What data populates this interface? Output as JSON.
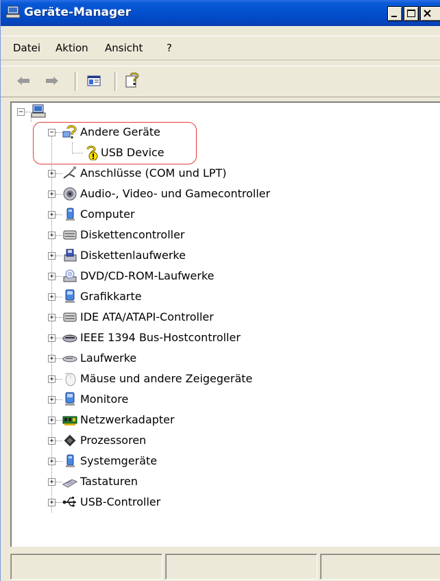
{
  "window": {
    "title": "Geräte-Manager"
  },
  "menu": {
    "items": [
      {
        "label": "Datei"
      },
      {
        "label": "Aktion"
      },
      {
        "label": "Ansicht"
      },
      {
        "label": "?"
      }
    ]
  },
  "toolbar": {
    "buttons": [
      {
        "icon": "back-arrow-icon"
      },
      {
        "icon": "forward-arrow-icon"
      },
      {
        "icon": "properties-icon"
      },
      {
        "icon": "help-icon"
      }
    ]
  },
  "tree": {
    "root": {
      "icon": "computer-icon",
      "expanded": true
    },
    "groups": [
      {
        "label": "Andere Geräte",
        "expanded": true,
        "icon": "unknown-device-icon",
        "children": [
          {
            "label": "USB Device",
            "icon": "warning-device-icon"
          }
        ]
      },
      {
        "label": "Anschlüsse (COM und LPT)",
        "icon": "port-icon"
      },
      {
        "label": "Audio-, Video- und Gamecontroller",
        "icon": "speaker-icon"
      },
      {
        "label": "Computer",
        "icon": "computer-icon"
      },
      {
        "label": "Diskettencontroller",
        "icon": "controller-icon"
      },
      {
        "label": "Diskettenlaufwerke",
        "icon": "floppy-icon"
      },
      {
        "label": "DVD/CD-ROM-Laufwerke",
        "icon": "cdrom-icon"
      },
      {
        "label": "Grafikkarte",
        "icon": "monitor-icon"
      },
      {
        "label": "IDE ATA/ATAPI-Controller",
        "icon": "controller-icon"
      },
      {
        "label": "IEEE 1394 Bus-Hostcontroller",
        "icon": "firewire-icon"
      },
      {
        "label": "Laufwerke",
        "icon": "drive-icon"
      },
      {
        "label": "Mäuse und andere Zeigegeräte",
        "icon": "mouse-icon"
      },
      {
        "label": "Monitore",
        "icon": "monitor-icon"
      },
      {
        "label": "Netzwerkadapter",
        "icon": "network-card-icon"
      },
      {
        "label": "Prozessoren",
        "icon": "processor-icon"
      },
      {
        "label": "Systemgeräte",
        "icon": "system-device-icon"
      },
      {
        "label": "Tastaturen",
        "icon": "keyboard-icon"
      },
      {
        "label": "USB-Controller",
        "icon": "usb-icon"
      }
    ]
  },
  "colors": {
    "titlebar": "#0353d0",
    "highlight_outline": "#e33a3a",
    "window_bg": "#ece9d8"
  }
}
